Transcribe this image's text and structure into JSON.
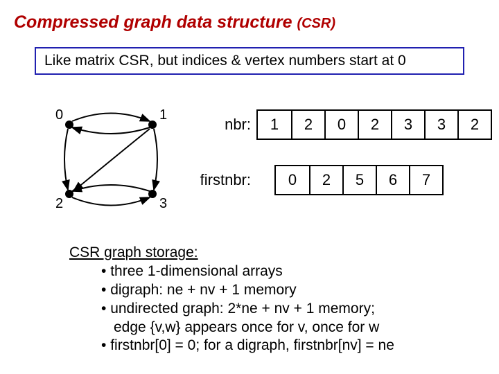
{
  "title": {
    "main": "Compressed graph data structure",
    "paren": "(CSR)"
  },
  "subtitle": "Like matrix CSR, but indices & vertex numbers start at 0",
  "graph": {
    "v0": "0",
    "v1": "1",
    "v2": "2",
    "v3": "3"
  },
  "arrays": {
    "nbr_label": "nbr:",
    "nbr": [
      "1",
      "2",
      "0",
      "2",
      "3",
      "3",
      "2"
    ],
    "firstnbr_label": "firstnbr:",
    "firstnbr": [
      "0",
      "2",
      "5",
      "6",
      "7"
    ]
  },
  "storage": {
    "head": "CSR graph storage:",
    "b1": "three 1-dimensional arrays",
    "b2": "digraph:  ne + nv + 1 memory",
    "b3a": "undirected graph: 2*ne + nv + 1 memory;",
    "b3b": "edge {v,w} appears once for v, once for w",
    "b4": "firstnbr[0] = 0; for a digraph, firstnbr[nv] = ne"
  }
}
